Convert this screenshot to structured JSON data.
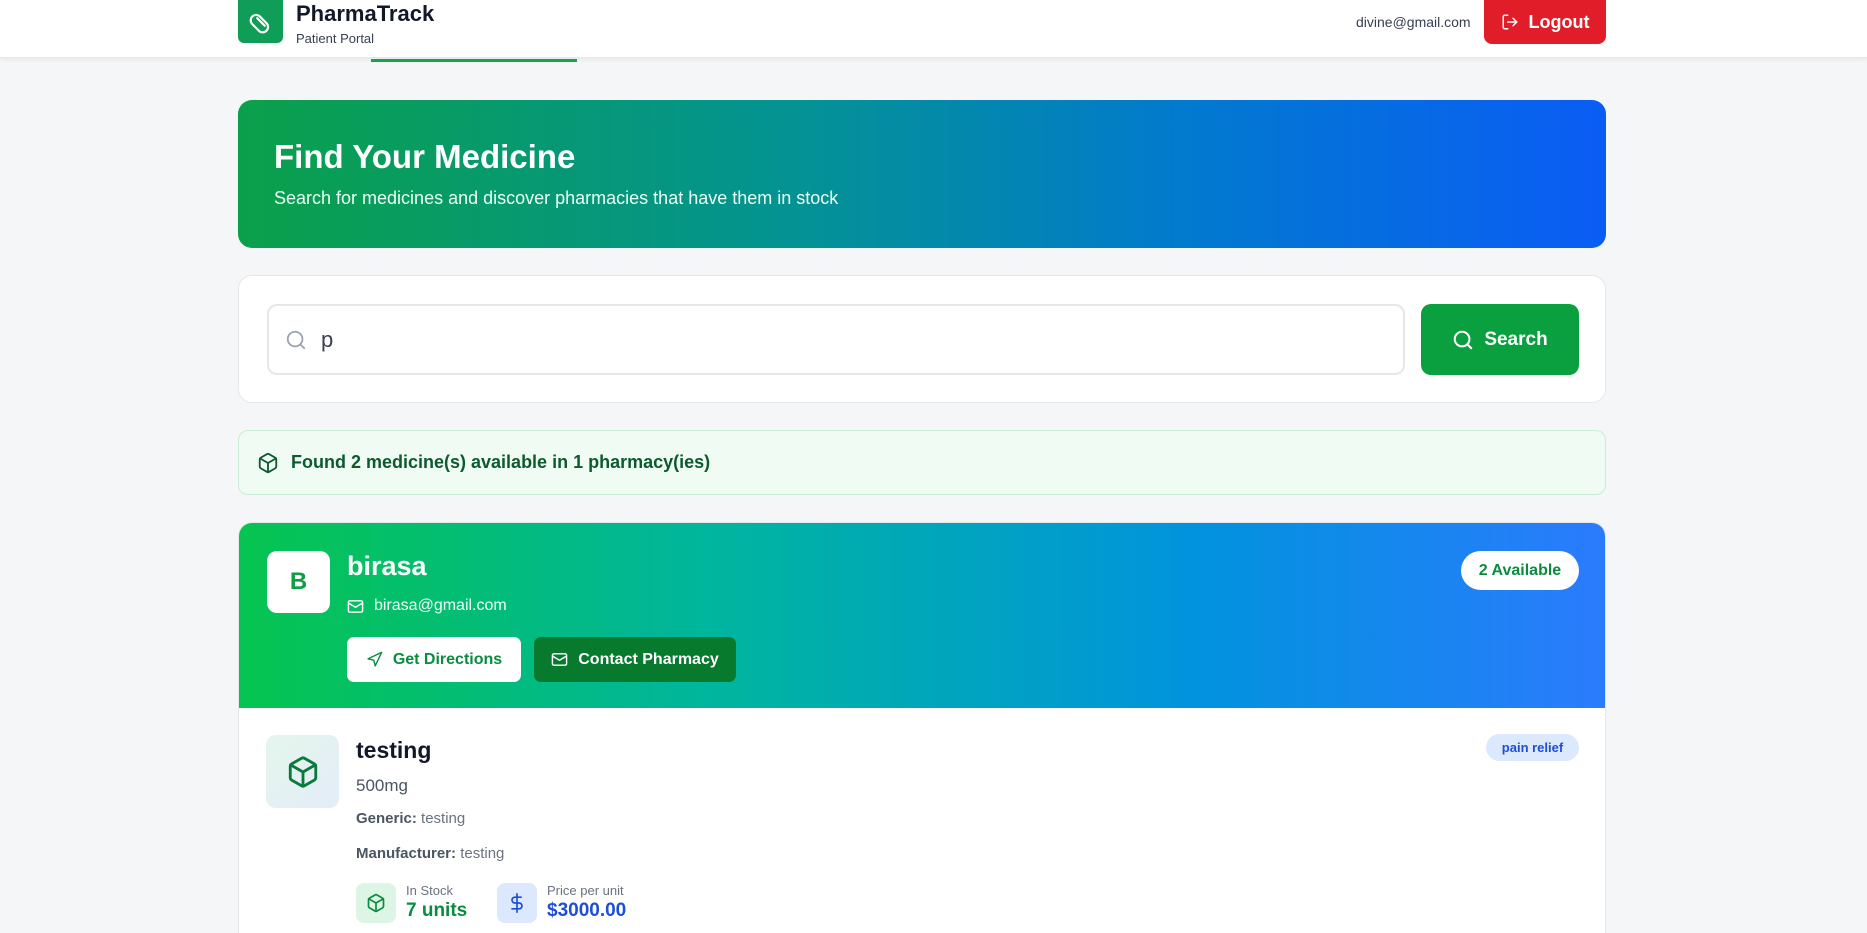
{
  "header": {
    "brand_name": "PharmaTrack",
    "brand_sub": "Patient Portal",
    "user_email": "divine@gmail.com",
    "logout_label": "Logout"
  },
  "hero": {
    "title": "Find Your Medicine",
    "subtitle": "Search for medicines and discover pharmacies that have them in stock"
  },
  "search": {
    "query": "p",
    "button_label": "Search"
  },
  "results": {
    "summary": "Found 2 medicine(s) available in 1 pharmacy(ies)"
  },
  "pharmacy": {
    "initial": "B",
    "name": "birasa",
    "email": "birasa@gmail.com",
    "available_badge": "2 Available",
    "directions_label": "Get Directions",
    "contact_label": "Contact Pharmacy"
  },
  "medicine": {
    "name": "testing",
    "strength": "500mg",
    "generic_label": "Generic:",
    "generic_value": "testing",
    "manufacturer_label": "Manufacturer:",
    "manufacturer_value": "testing",
    "category": "pain relief",
    "stock_label": "In Stock",
    "stock_value": "7 units",
    "price_label": "Price per unit",
    "price_value": "$3000.00"
  },
  "icons": {
    "logo": "pill-icon",
    "logout": "logout-icon",
    "search": "search-icon",
    "results": "package-icon",
    "email": "mail-icon",
    "directions": "navigation-icon",
    "contact": "mail-icon",
    "medicine": "package-icon",
    "stock": "package-icon",
    "price": "dollar-icon"
  },
  "colors": {
    "brand_green": "#0aa03f",
    "logout_red": "#e11d2a",
    "price_blue": "#1d4ed8",
    "stock_green": "#0a8c3f"
  }
}
